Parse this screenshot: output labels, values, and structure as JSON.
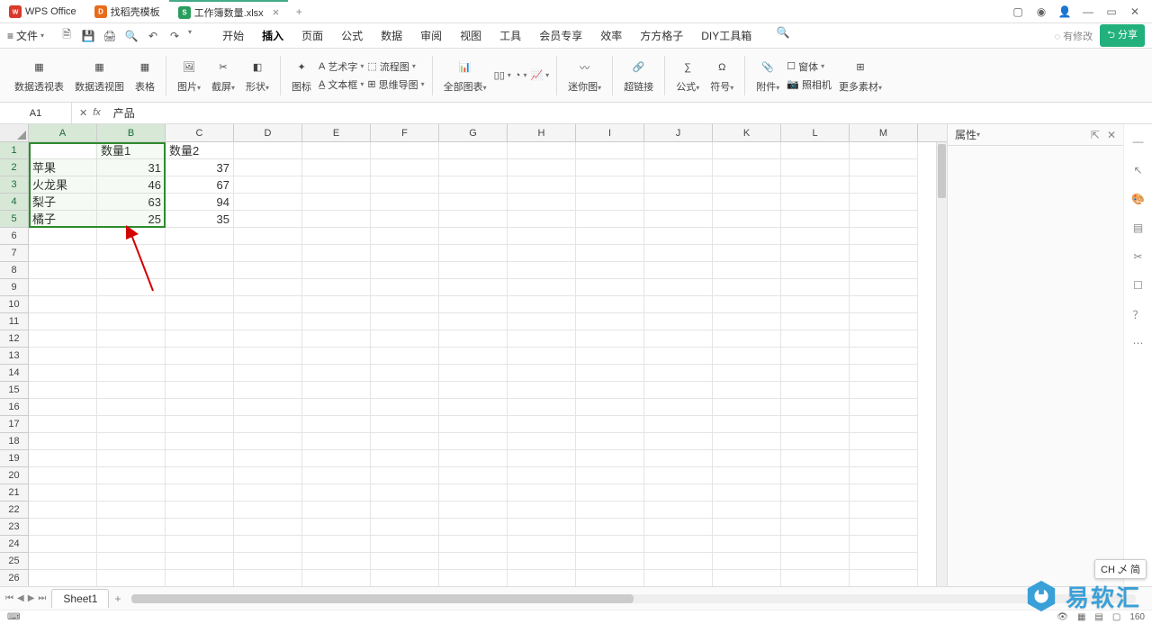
{
  "titlebar": {
    "app_tab": "WPS Office",
    "tab2": "找稻壳模板",
    "tab3": "工作簿数量.xlsx",
    "new_tab": "+"
  },
  "menubar": {
    "file": "文件",
    "tabs": [
      "开始",
      "插入",
      "页面",
      "公式",
      "数据",
      "审阅",
      "视图",
      "工具",
      "会员专享",
      "效率",
      "方方格子",
      "DIY工具箱"
    ],
    "active_index": 1,
    "modified": "有修改",
    "share": "分享"
  },
  "ribbon": {
    "pivot1": "数据透视表",
    "pivot2": "数据透视图",
    "table": "表格",
    "pic": "图片",
    "screenshot": "截屏",
    "shape": "形状",
    "icon": "图标",
    "art": "艺术字",
    "textbox": "文本框",
    "flow": "流程图",
    "mind": "思维导图",
    "allchart": "全部图表",
    "spark": "迷你图",
    "link": "超链接",
    "formula": "公式",
    "symbol": "符号",
    "attach": "附件",
    "form": "窗体",
    "camera": "照相机",
    "more": "更多素材"
  },
  "fbar": {
    "namebox": "A1",
    "formula": "产品"
  },
  "columns": [
    "A",
    "B",
    "C",
    "D",
    "E",
    "F",
    "G",
    "H",
    "I",
    "J",
    "K",
    "L",
    "M"
  ],
  "rows_count": 28,
  "grid": {
    "headers": [
      "产品",
      "数量1",
      "数量2"
    ],
    "data": [
      {
        "a": "苹果",
        "b": "31",
        "c": "37"
      },
      {
        "a": "火龙果",
        "b": "46",
        "c": "67"
      },
      {
        "a": "梨子",
        "b": "63",
        "c": "94"
      },
      {
        "a": "橘子",
        "b": "25",
        "c": "35"
      }
    ]
  },
  "right_panel": {
    "title": "属性"
  },
  "sheet_tabs": {
    "sheet1": "Sheet1"
  },
  "status": {
    "zoom": "160"
  },
  "ime": "CH 乄 简",
  "watermark": "易软汇"
}
